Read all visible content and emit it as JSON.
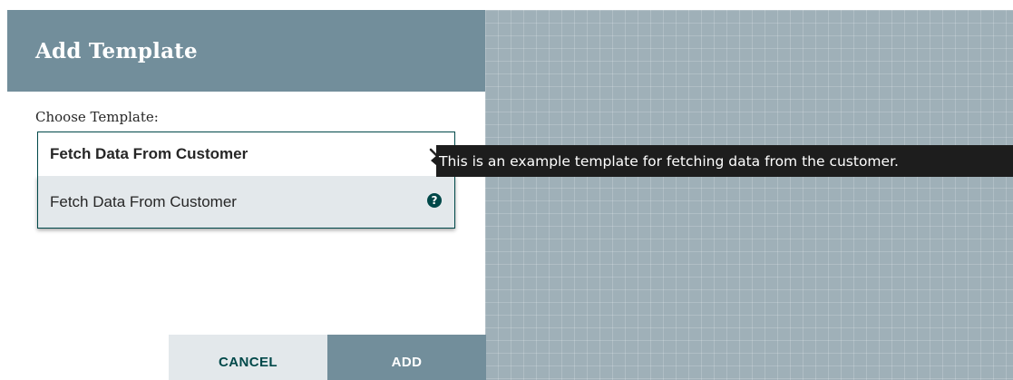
{
  "dialog": {
    "title": "Add Template",
    "field_label": "Choose Template:",
    "selected_value": "Fetch Data From Customer",
    "options": [
      {
        "label": "Fetch Data From Customer",
        "help_icon": "question-circle-icon"
      }
    ],
    "cancel_label": "CANCEL",
    "add_label": "ADD"
  },
  "tooltip": {
    "text": "This is an example template for fetching data from the customer."
  },
  "icons": {
    "dropdown": "chevron-down-icon",
    "help": "question-circle-icon"
  },
  "colors": {
    "header_bg": "#728e9b",
    "accent_dark": "#004849",
    "secondary_button_bg": "#e3e8eb",
    "canvas_bg": "#9fb0b8",
    "tooltip_bg": "#1d1d1d"
  }
}
